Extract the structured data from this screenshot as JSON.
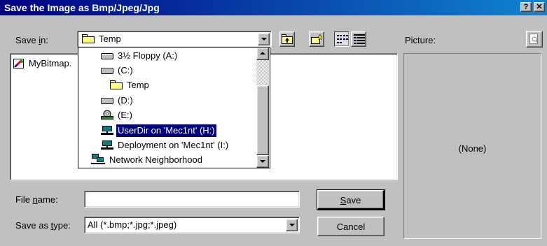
{
  "window": {
    "title": "Save the Image as Bmp/Jpeg/Jpg",
    "help_glyph": "?",
    "close_glyph": "✕"
  },
  "save_in": {
    "label_pre": "Save ",
    "label_key": "i",
    "label_post": "n:",
    "value": "Temp"
  },
  "dropdown_items": [
    {
      "label": "3½ Floppy (A:)",
      "icon": "floppy-drive-icon"
    },
    {
      "label": "(C:)",
      "icon": "hard-drive-icon"
    },
    {
      "label": "Temp",
      "icon": "folder-icon"
    },
    {
      "label": "(D:)",
      "icon": "hard-drive-icon"
    },
    {
      "label": "(E:)",
      "icon": "cd-drive-icon"
    },
    {
      "label": "UserDir on 'Mec1nt' (H:)",
      "icon": "network-drive-icon",
      "selected": true
    },
    {
      "label": "Deployment on 'Mec1nt' (I:)",
      "icon": "network-drive-icon"
    },
    {
      "label": "Network Neighborhood",
      "icon": "network-neighborhood-icon"
    }
  ],
  "file_list": [
    {
      "label": "MyBitmap.",
      "icon": "bitmap-file-icon"
    }
  ],
  "picture": {
    "label": "Picture:",
    "preview_text": "(None)"
  },
  "file_name": {
    "label_pre": "File ",
    "label_key": "n",
    "label_post": "ame:",
    "value": ""
  },
  "save_type": {
    "label_pre": "Save as ",
    "label_key": "t",
    "label_post": "ype:",
    "value": "All (*.bmp;*.jpg;*.jpeg)"
  },
  "buttons": {
    "save_key": "S",
    "save_rest": "ave",
    "cancel": "Cancel"
  }
}
